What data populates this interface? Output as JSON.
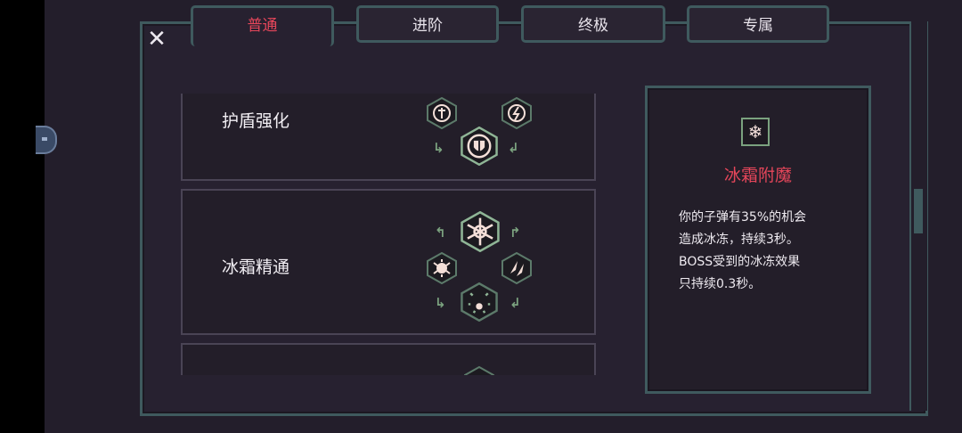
{
  "tabs": [
    {
      "label": "普通",
      "active": true
    },
    {
      "label": "进阶",
      "active": false
    },
    {
      "label": "终极",
      "active": false
    },
    {
      "label": "专属",
      "active": false
    }
  ],
  "close_icon": "close-icon",
  "skills": [
    {
      "title": "护盾强化",
      "icons": [
        "sword-hex-icon",
        "lightning-hex-icon",
        "shield-hex-icon"
      ]
    },
    {
      "title": "冰霜精通",
      "icons": [
        "snowflake-hex-icon",
        "frost-bug-hex-icon",
        "ice-shards-hex-icon",
        "frost-burst-hex-icon"
      ]
    },
    {
      "title": "",
      "icons": [
        "hex-icon"
      ]
    }
  ],
  "detail": {
    "icon": "snowflake-icon",
    "title": "冰霜附魔",
    "lines": [
      "你的子弹有35%的机会",
      "造成冰冻，持续3秒。",
      "BOSS受到的冰冻效果",
      "只持续0.3秒。"
    ]
  },
  "colors": {
    "accent_red": "#e5465a",
    "frame_teal": "#3f5a5e",
    "arrow_green": "#7ba27f",
    "background": "#231e2b"
  }
}
